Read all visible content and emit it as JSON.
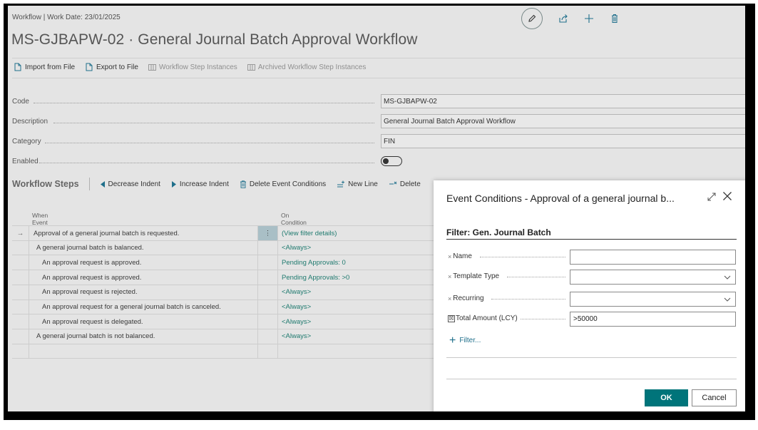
{
  "header": {
    "breadcrumb": "Workflow | Work Date: 23/01/2025",
    "title": "MS-GJBAPW-02 · General Journal Batch Approval Workflow",
    "icons": [
      "edit-icon",
      "share-icon",
      "add-icon",
      "delete-icon"
    ]
  },
  "actions": {
    "import": "Import from File",
    "export": "Export to File",
    "instances": "Workflow Step Instances",
    "archived": "Archived Workflow Step Instances"
  },
  "fields": {
    "code": {
      "label": "Code",
      "value": "MS-GJBAPW-02"
    },
    "description": {
      "label": "Description",
      "value": "General Journal Batch Approval Workflow"
    },
    "category": {
      "label": "Category",
      "value": "FIN"
    },
    "enabled": {
      "label": "Enabled",
      "value": false
    }
  },
  "steps": {
    "title": "Workflow Steps",
    "decrease": "Decrease Indent",
    "increase": "Increase Indent",
    "delete_conditions": "Delete Event Conditions",
    "new_line": "New Line",
    "delete_line": "Delete",
    "col_when": "When Event",
    "col_on": "On Condition",
    "rows": [
      {
        "when": "Approval of a general journal batch is requested.",
        "on": "(View filter details)",
        "marker": "→",
        "menu": "⋮"
      },
      {
        "when": "A general journal batch is balanced.",
        "on": "<Always>",
        "marker": "",
        "menu": ""
      },
      {
        "when": "An approval request is approved.",
        "on": "Pending Approvals: 0",
        "marker": "",
        "menu": ""
      },
      {
        "when": "An approval request is approved.",
        "on": "Pending Approvals: >0",
        "marker": "",
        "menu": ""
      },
      {
        "when": "An approval request is rejected.",
        "on": "<Always>",
        "marker": "",
        "menu": ""
      },
      {
        "when": "An approval request for a general journal batch is canceled.",
        "on": "<Always>",
        "marker": "",
        "menu": ""
      },
      {
        "when": "An approval request is delegated.",
        "on": "<Always>",
        "marker": "",
        "menu": ""
      },
      {
        "when": "A general journal batch is not balanced.",
        "on": "<Always>",
        "marker": "",
        "menu": ""
      },
      {
        "when": "",
        "on": "",
        "marker": "",
        "menu": ""
      }
    ]
  },
  "dialog": {
    "title": "Event Conditions - Approval of a general journal b...",
    "filter_heading": "Filter: Gen. Journal Batch",
    "filters": [
      {
        "label": "Name",
        "value": "",
        "marker": "×"
      },
      {
        "label": "Template Type",
        "value": "",
        "marker": "×"
      },
      {
        "label": "Recurring",
        "value": "",
        "marker": "×"
      },
      {
        "label": "Total Amount (LCY)",
        "value": ">50000",
        "marker": "☒"
      }
    ],
    "add_filter": "Filter...",
    "ok": "OK",
    "cancel": "Cancel"
  },
  "colors": {
    "accent": "#00747a",
    "link": "#1f7a6f",
    "background": "#e4e4e4"
  }
}
